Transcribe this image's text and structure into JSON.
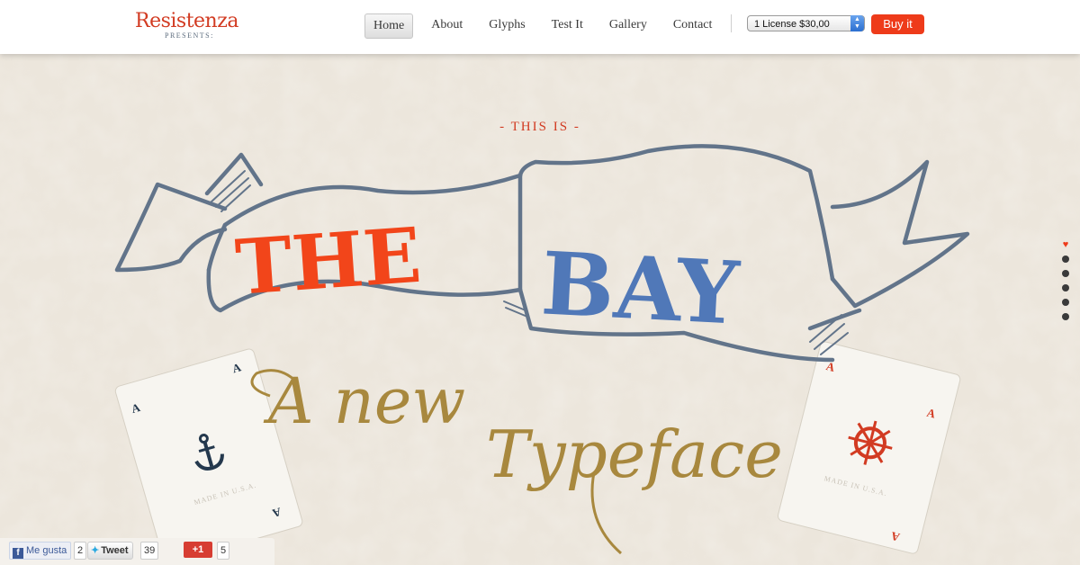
{
  "header": {
    "logo_name": "Resistenza",
    "logo_sub": "PRESENTS:",
    "nav": [
      "Home",
      "About",
      "Glyphs",
      "Test It",
      "Gallery",
      "Contact"
    ],
    "active_nav": "Home",
    "license_select": "1 License $30,00",
    "buy_label": "Buy it"
  },
  "hero": {
    "eyebrow": "- THIS IS -",
    "banner_left": "THE",
    "banner_right": "BAY",
    "script_line1": "A new",
    "script_line2": "Typeface",
    "card_left_made_in": "MADE IN U.S.A.",
    "card_right_made_in": "MADE IN U.S.A.",
    "card_rank": "A",
    "card_left_icon": "anchor-icon",
    "card_right_icon": "ship-wheel-icon",
    "slide_count": 6,
    "active_slide": 1
  },
  "social": {
    "facebook_label": "Me gusta",
    "facebook_count": "2",
    "twitter_label": "Tweet",
    "twitter_count": "39",
    "gplus_label": "+1",
    "gplus_count": "5"
  },
  "colors": {
    "accent_red": "#ee3b1a",
    "banner_blue": "#5078b8",
    "script_gold": "#a8883e",
    "outline_slate": "#62748a",
    "background": "#ece6dc"
  }
}
